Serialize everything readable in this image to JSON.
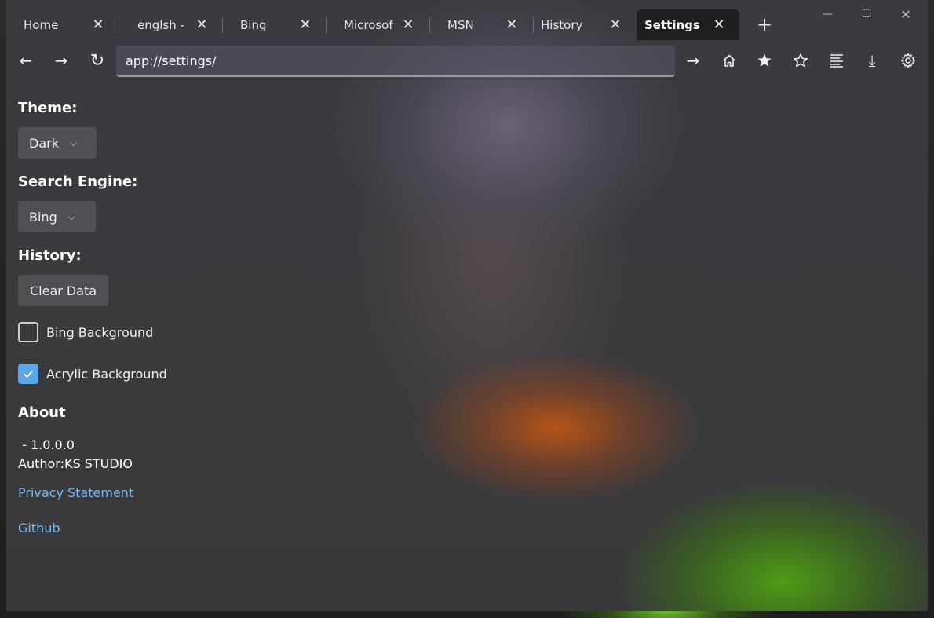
{
  "tabs": [
    {
      "label": "Home",
      "close": "✕"
    },
    {
      "label": "englsh -",
      "close": "✕"
    },
    {
      "label": "Bing",
      "close": "✕"
    },
    {
      "label": "Microsof",
      "close": "✕"
    },
    {
      "label": "MSN",
      "close": "✕"
    },
    {
      "label": "History",
      "close": "✕"
    },
    {
      "label": "Settings",
      "close": "✕",
      "active": true
    }
  ],
  "new_tab": "+",
  "window_controls": {
    "minimize": "—",
    "maximize": "☐",
    "close": "✕"
  },
  "nav": {
    "back": "←",
    "forward": "→",
    "refresh": "↻",
    "go": "→",
    "home_icon": "home-icon",
    "favorite_add_icon": "star-filled-icon",
    "favorites_icon": "star-outline-icon",
    "reading_icon": "lines-icon",
    "download": "⤓",
    "settings_icon": "gear-icon"
  },
  "address": {
    "value": "app://settings/"
  },
  "settings": {
    "theme_heading": "Theme:",
    "theme_value": "Dark",
    "search_heading": "Search Engine:",
    "search_value": "Bing",
    "history_heading": "History:",
    "clear_label": "Clear Data",
    "bing_bg_label": "Bing Background",
    "bing_bg_checked": false,
    "acrylic_bg_label": "Acrylic Background",
    "acrylic_bg_checked": true,
    "about_heading": "About",
    "version": " - 1.0.0.0",
    "author": "Author:KS STUDIO",
    "privacy_link": "Privacy Statement",
    "github_link": "Github"
  },
  "colors": {
    "accent": "#5aa6e6",
    "link": "#79b8ee"
  }
}
